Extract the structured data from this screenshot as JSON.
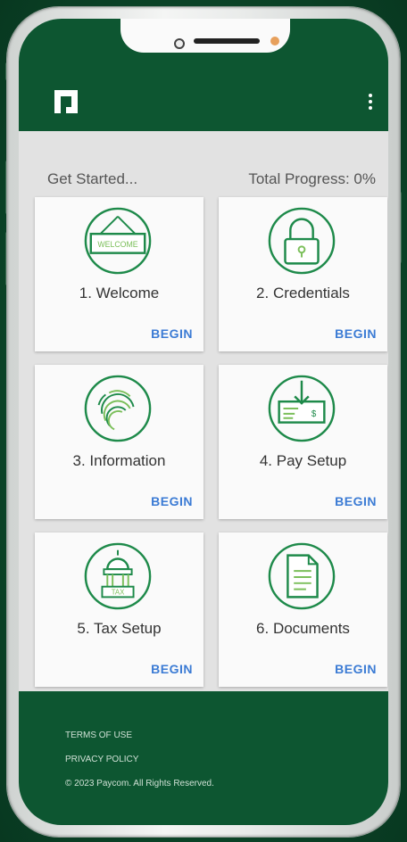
{
  "header": {
    "logo_icon": "paycom-logo-icon",
    "menu_icon": "kebab-menu-icon",
    "brand_color": "#0d5631"
  },
  "progress": {
    "left_label": "Get Started...",
    "right_label": "Total Progress: 0%"
  },
  "cards": [
    {
      "title": "1. Welcome",
      "action": "BEGIN",
      "icon": "welcome-sign-icon"
    },
    {
      "title": "2. Credentials",
      "action": "BEGIN",
      "icon": "padlock-icon"
    },
    {
      "title": "3. Information",
      "action": "BEGIN",
      "icon": "fingerprint-icon"
    },
    {
      "title": "4. Pay Setup",
      "action": "BEGIN",
      "icon": "paycheck-icon"
    },
    {
      "title": "5. Tax Setup",
      "action": "BEGIN",
      "icon": "capitol-tax-icon"
    },
    {
      "title": "6. Documents",
      "action": "BEGIN",
      "icon": "document-icon"
    }
  ],
  "footer": {
    "terms": "TERMS OF USE",
    "privacy": "PRIVACY POLICY",
    "copyright": "© 2023 Paycom. All Rights Reserved."
  },
  "colors": {
    "icon_green": "#1e8a4a",
    "icon_light": "#9fd36a",
    "action_blue": "#3b7bd4"
  }
}
